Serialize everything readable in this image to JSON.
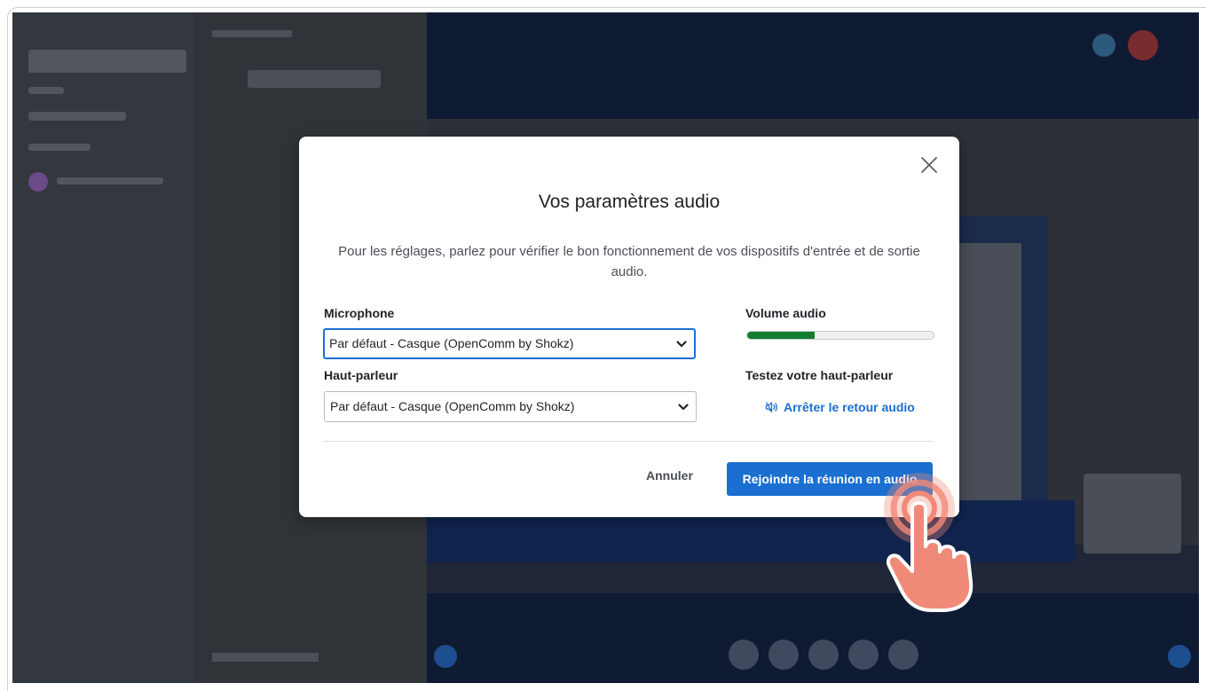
{
  "dialog": {
    "title": "Vos paramètres audio",
    "description": "Pour les réglages, parlez pour vérifier le bon fonctionnement de vos dispositifs d'entrée et de sortie audio.",
    "microphone": {
      "label": "Microphone",
      "selected": "Par défaut - Casque (OpenComm by Shokz)"
    },
    "speaker": {
      "label": "Haut-parleur",
      "selected": "Par défaut - Casque (OpenComm by Shokz)"
    },
    "volume": {
      "label": "Volume audio",
      "level_percent": 36
    },
    "speaker_test": {
      "label": "Testez votre haut-parleur",
      "link": "Arrêter le retour audio"
    },
    "cancel_label": "Annuler",
    "join_label": "Rejoindre la réunion en audio"
  },
  "colors": {
    "accent": "#1a6fd0",
    "volume_fill": "#127d2e",
    "cursor": "#f08a78"
  },
  "icons": [
    "close-icon",
    "chevron-down-icon",
    "speaker-icon",
    "tap-hand-icon"
  ]
}
